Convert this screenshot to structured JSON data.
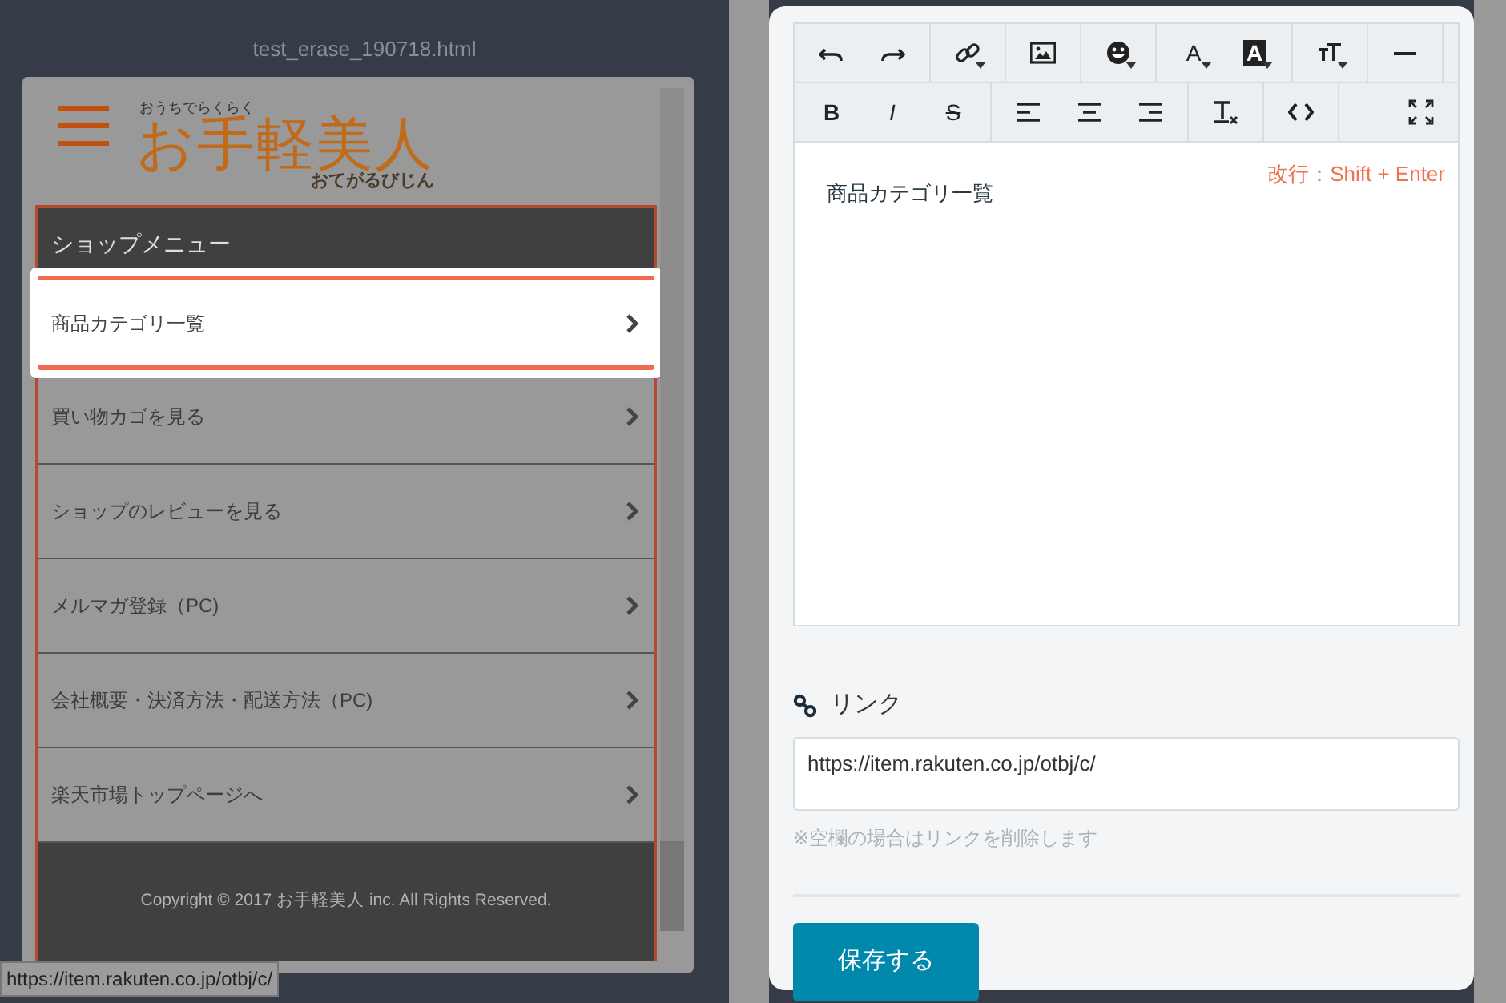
{
  "preview": {
    "file_title": "test_erase_190718.html",
    "logo": {
      "tagline": "おうちでらくらく",
      "name": "お手軽美人",
      "reading": "おてがるびじん"
    },
    "menu_title": "ショップメニュー",
    "menu_items": [
      {
        "label": "商品カテゴリ一覧",
        "selected": true
      },
      {
        "label": "買い物カゴを見る",
        "selected": false
      },
      {
        "label": "ショップのレビューを見る",
        "selected": false
      },
      {
        "label": "メルマガ登録（PC)",
        "selected": false
      },
      {
        "label": "会社概要・決済方法・配送方法（PC)",
        "selected": false
      },
      {
        "label": "楽天市場トップページへ",
        "selected": false
      }
    ],
    "footer": "Copyright © 2017 お手軽美人 inc. All Rights Reserved.",
    "status_url": "https://item.rakuten.co.jp/otbj/c/"
  },
  "editor": {
    "toolbar": [
      [
        [
          {
            "kind": "undo",
            "dropdown": false
          },
          {
            "kind": "redo",
            "dropdown": false
          }
        ],
        [
          {
            "kind": "link",
            "dropdown": true
          }
        ],
        [
          {
            "kind": "image",
            "dropdown": false
          }
        ],
        [
          {
            "kind": "emoji",
            "dropdown": true
          }
        ],
        [
          {
            "kind": "fontcolor",
            "label": "A",
            "dropdown": true
          },
          {
            "kind": "highlight",
            "label": "A",
            "dropdown": true
          }
        ],
        [
          {
            "kind": "textsize",
            "dropdown": true
          }
        ],
        [
          {
            "kind": "rule",
            "dropdown": false
          }
        ]
      ],
      [
        [
          {
            "kind": "bold",
            "label": "B",
            "dropdown": false
          },
          {
            "kind": "italic",
            "label": "I",
            "dropdown": false
          },
          {
            "kind": "strike",
            "label": "S",
            "dropdown": false
          }
        ],
        [
          {
            "kind": "alignleft",
            "dropdown": false
          },
          {
            "kind": "aligncenter",
            "dropdown": false
          },
          {
            "kind": "alignright",
            "dropdown": false
          }
        ],
        [
          {
            "kind": "clearformat",
            "dropdown": false
          }
        ],
        [
          {
            "kind": "code",
            "dropdown": false
          }
        ],
        [
          {
            "kind": "fullscreen",
            "dropdown": false
          }
        ]
      ]
    ],
    "content": "商品カテゴリ一覧",
    "hint": "改行：Shift + Enter",
    "link_label": "リンク",
    "link_value": "https://item.rakuten.co.jp/otbj/c/",
    "link_note": "※空欄の場合はリンクを削除します",
    "save_button": "保存する"
  }
}
